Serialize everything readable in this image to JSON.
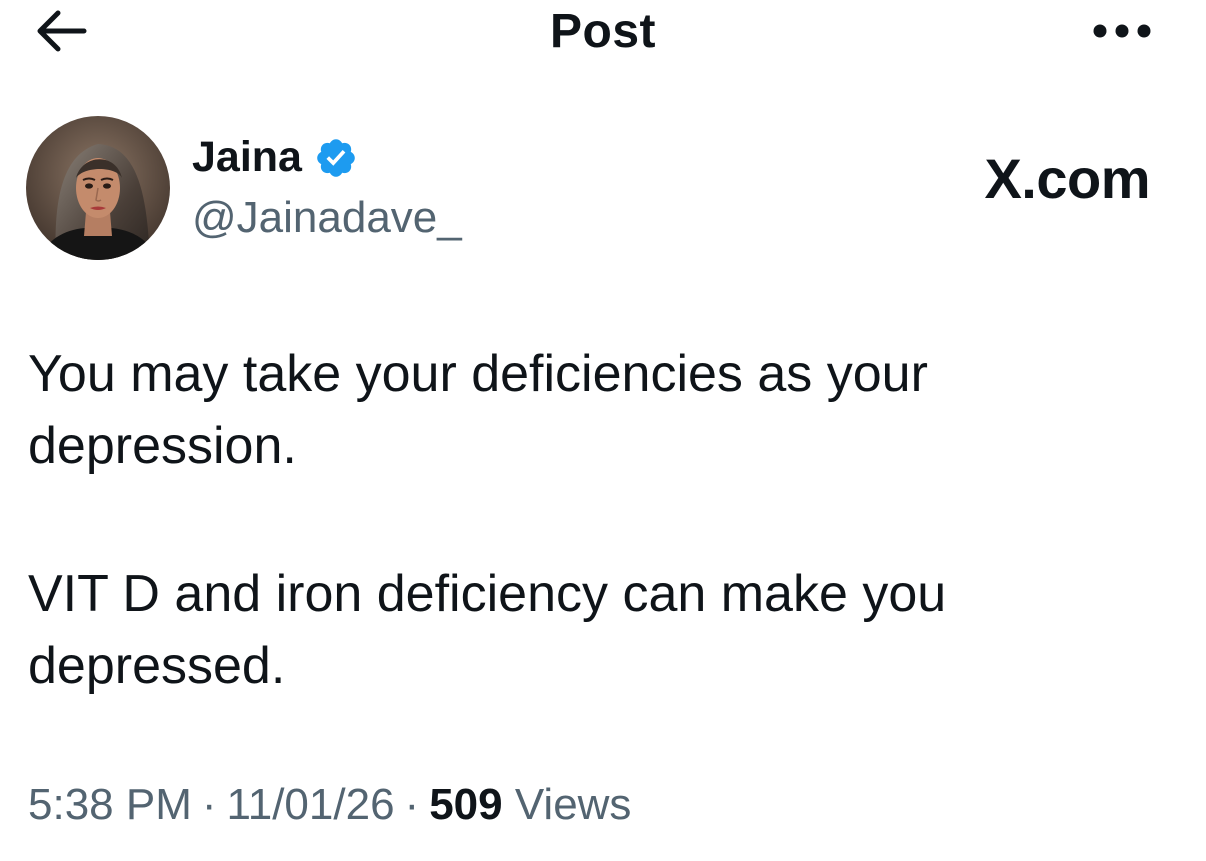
{
  "header": {
    "title": "Post",
    "back_icon": "arrow-left-icon",
    "more_icon": "ellipsis-horizontal-icon"
  },
  "author": {
    "display_name": "Jaina",
    "handle": "@Jainadave_",
    "verified": true,
    "verified_color": "#1d9bf0"
  },
  "watermark": "X.com",
  "post": {
    "paragraphs": [
      "You may take your deficiencies as your depression.",
      "VIT D and iron deficiency can make you depressed."
    ],
    "time": "5:38 PM",
    "date": "11/01/26",
    "separator": "·",
    "views_count": "509",
    "views_label": "Views"
  },
  "colors": {
    "text_primary": "#0f1419",
    "text_secondary": "#536471",
    "background": "#ffffff"
  }
}
